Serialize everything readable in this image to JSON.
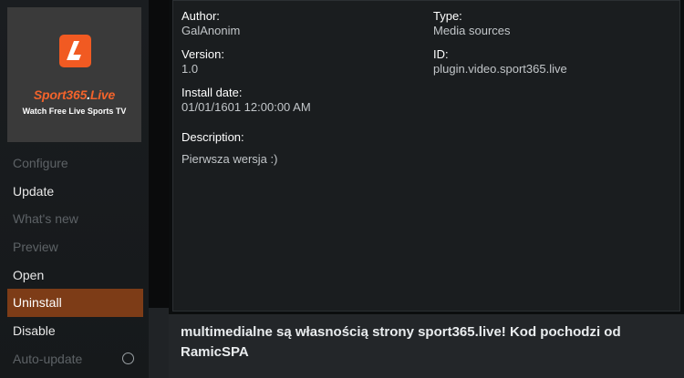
{
  "addon": {
    "brand_main": "Sport365",
    "brand_dot": ".",
    "brand_tail": "Live",
    "tagline": "Watch Free Live Sports TV",
    "logo_letter_color": "#ffffff",
    "logo_bg_color": "#f15a22"
  },
  "menu": {
    "items": [
      {
        "label": "Configure",
        "state": "disabled"
      },
      {
        "label": "Update",
        "state": "enabled"
      },
      {
        "label": "What's new",
        "state": "disabled"
      },
      {
        "label": "Preview",
        "state": "disabled"
      },
      {
        "label": "Open",
        "state": "enabled"
      },
      {
        "label": "Uninstall",
        "state": "active"
      },
      {
        "label": "Disable",
        "state": "enabled"
      },
      {
        "label": "Auto-update",
        "state": "disabled"
      }
    ],
    "active_color": "#7d3c17"
  },
  "info": {
    "author_label": "Author:",
    "author_value": "GalAnonim",
    "type_label": "Type:",
    "type_value": "Media sources",
    "version_label": "Version:",
    "version_value": "1.0",
    "id_label": "ID:",
    "id_value": "plugin.video.sport365.live",
    "install_label": "Install date:",
    "install_value": "01/01/1601 12:00:00 AM",
    "description_label": "Description:",
    "description_value": "Pierwsza wersja :)"
  },
  "footer": {
    "text": "multimedialne są własnością strony sport365.live! Kod pochodzi od RamicSPA"
  }
}
